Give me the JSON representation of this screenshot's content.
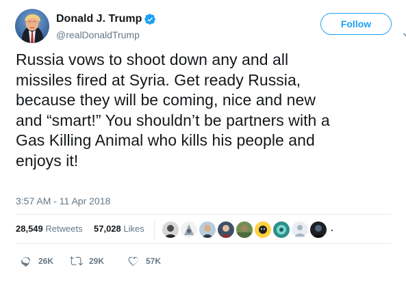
{
  "user": {
    "display_name": "Donald J. Trump",
    "screen_name": "@realDonaldTrump",
    "verified": true
  },
  "header": {
    "follow_label": "Follow",
    "caret_icon": "chevron-down-icon"
  },
  "tweet": {
    "text": "Russia vows to shoot down any and all\nmissiles fired at Syria. Get ready Russia,\nbecause they will be coming, nice and new\nand “smart!” You shouldn’t be partners with a\nGas Killing Animal who kills his people and\nenjoys it!",
    "timestamp": "3:57 AM - 11 Apr 2018"
  },
  "stats": {
    "retweets_value": "28,549",
    "retweets_label": "Retweets",
    "likes_value": "57,028",
    "likes_label": "Likes"
  },
  "actions": {
    "reply_count": "26K",
    "retweet_count": "29K",
    "like_count": "57K",
    "reply_icon": "reply-icon",
    "retweet_icon": "retweet-icon",
    "like_icon": "heart-icon"
  },
  "colors": {
    "brand_blue": "#1da1f2",
    "text_primary": "#14171a",
    "text_secondary": "#657786",
    "divider": "#e6ecf0"
  }
}
